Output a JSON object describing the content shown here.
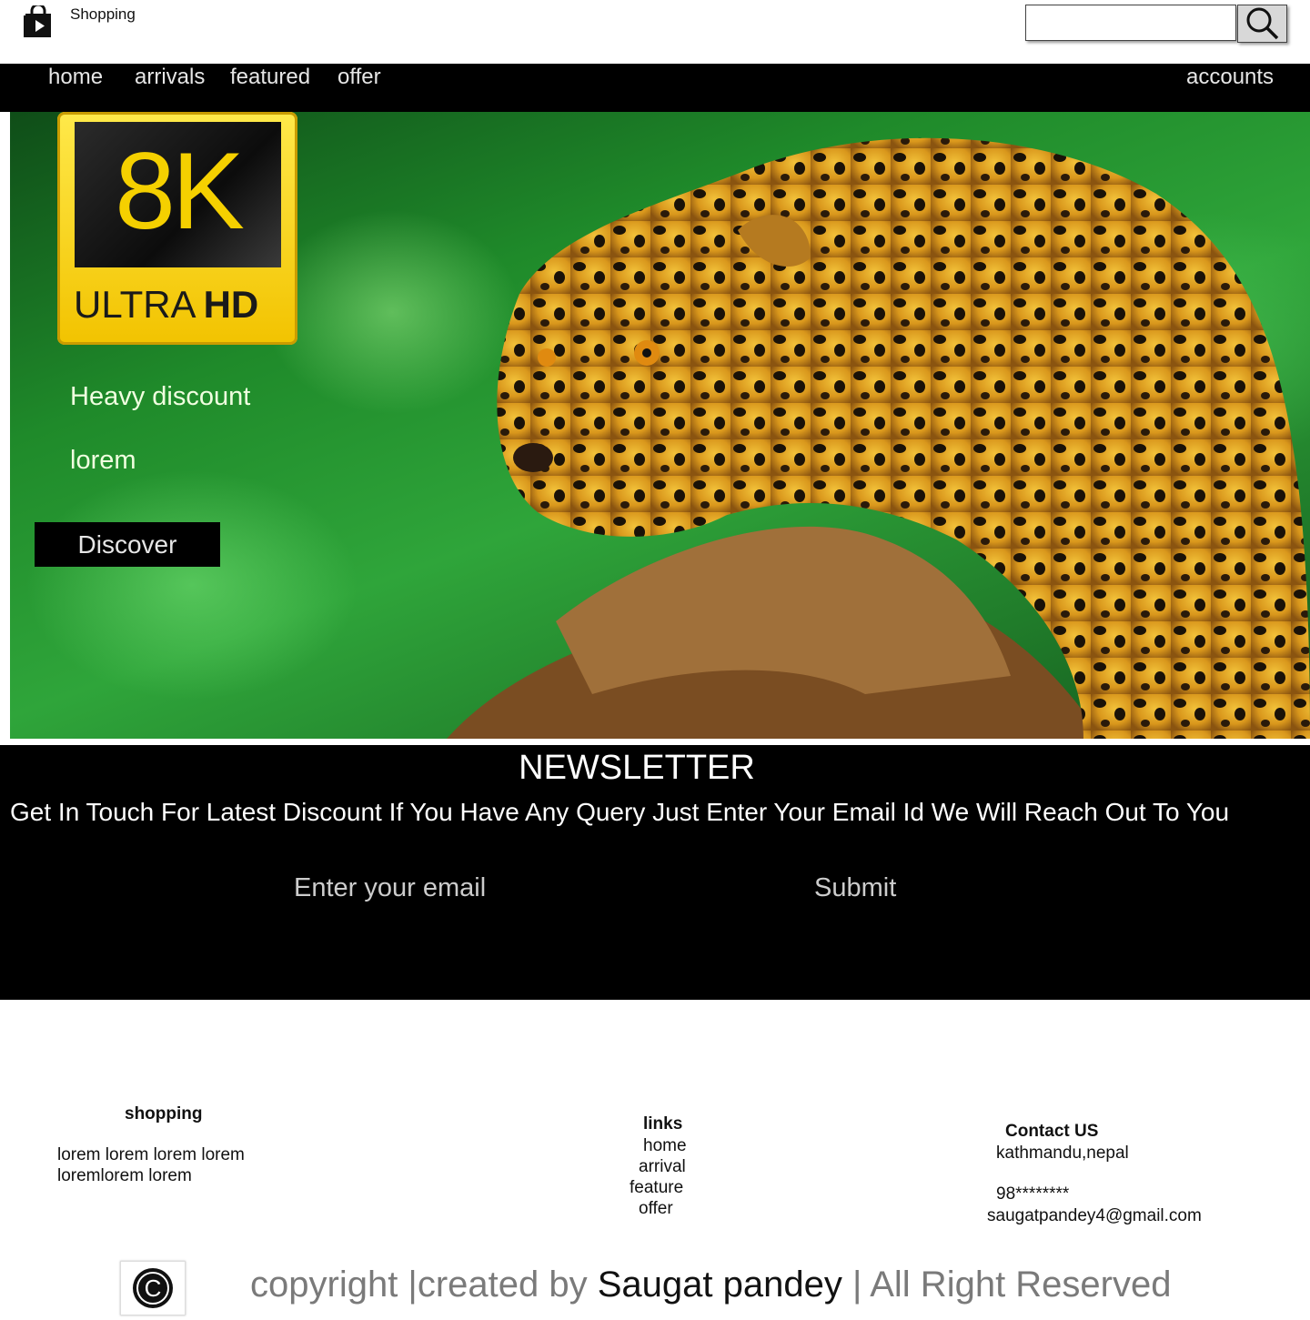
{
  "header": {
    "brand": "Shopping",
    "logo_icon": "shopping-bag-play-icon",
    "search": {
      "placeholder": "",
      "icon": "search-icon"
    }
  },
  "nav": {
    "items": [
      {
        "label": "home"
      },
      {
        "label": "arrivals"
      },
      {
        "label": "featured"
      },
      {
        "label": "offer"
      }
    ],
    "right": "accounts"
  },
  "hero": {
    "badge": {
      "big": "8K",
      "ultra": "ULTRA",
      "hd": "HD"
    },
    "line1": "Heavy discount",
    "line2": "lorem",
    "button": "Discover"
  },
  "newsletter": {
    "title": "NEWSLETTER",
    "text": "Get In Touch For Latest Discount If You Have Any Query Just Enter Your Email Id We Will Reach Out To You",
    "email_placeholder": "Enter your email",
    "submit": "Submit"
  },
  "footer": {
    "shopping": {
      "title": "shopping",
      "line1": "lorem lorem lorem lorem",
      "line2": "loremlorem lorem"
    },
    "links": {
      "title": "links",
      "items": [
        "home",
        "arrival",
        "feature",
        "offer"
      ]
    },
    "contact": {
      "title": "Contact US",
      "address": "kathmandu,nepal",
      "phone": "98********",
      "email": "saugatpandey4@gmail.com"
    },
    "copyright": {
      "part1": "copyright |",
      "part2": "created by ",
      "author": "Saugat pandey",
      "part3": " |  All Right Reserved",
      "icon": "copyright-icon"
    }
  },
  "colors": {
    "nav_bg": "#000000",
    "text_on_dark": "#e6e6e6",
    "footer_grey": "#7a7a7a",
    "badge_yellow": "#f5d000"
  }
}
